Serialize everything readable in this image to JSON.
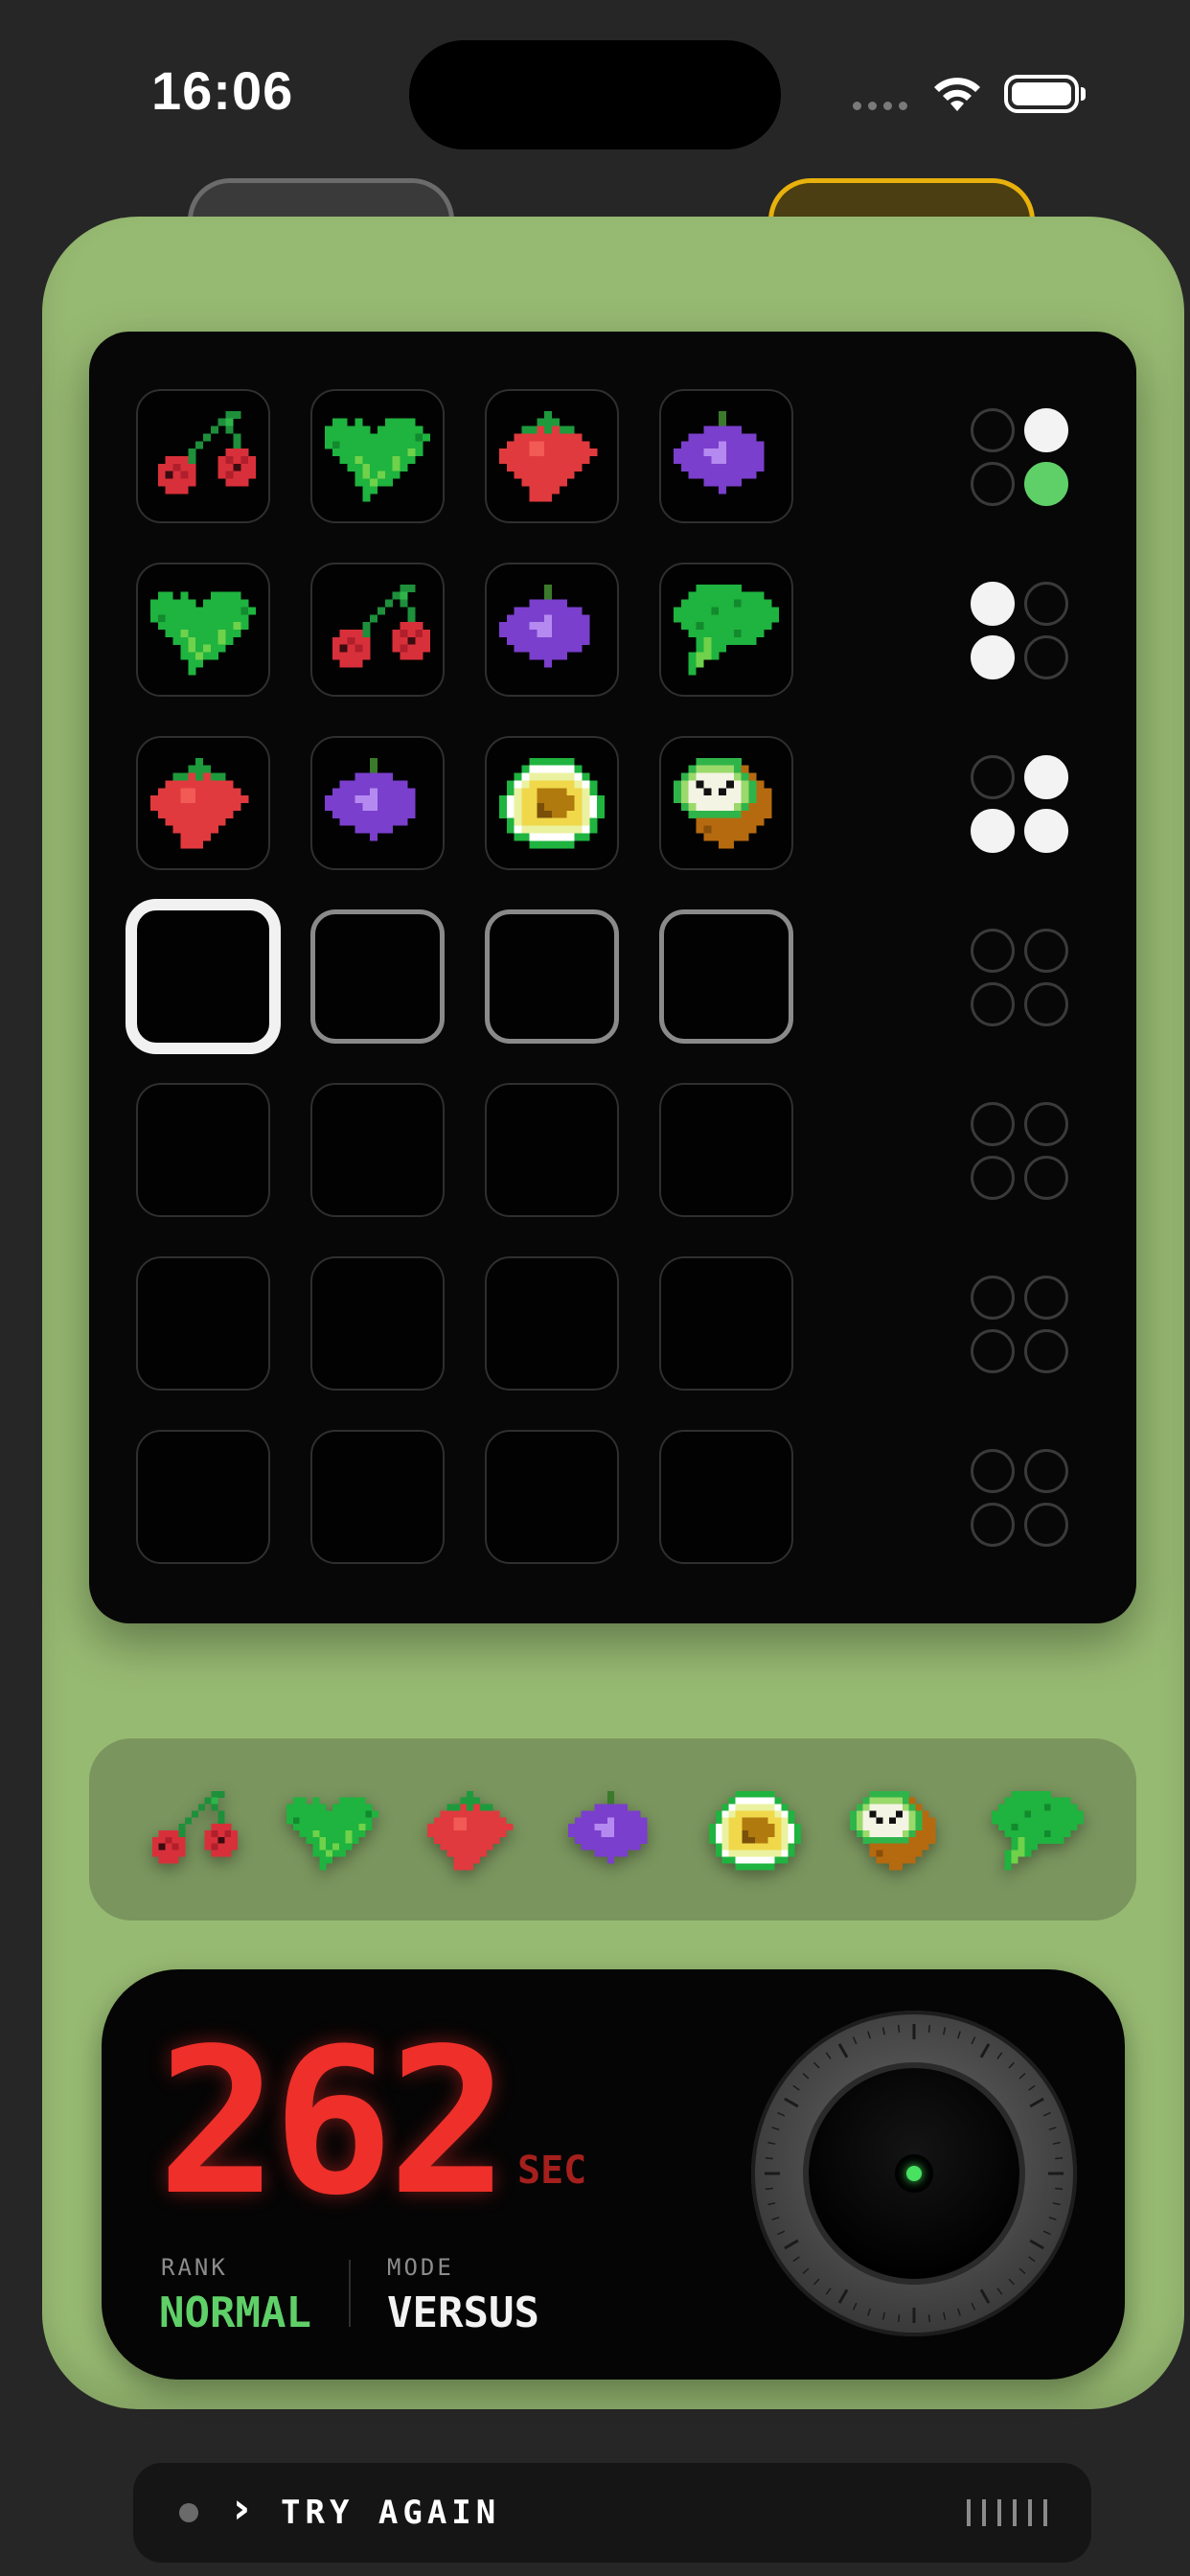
{
  "status_bar": {
    "time": "16:06",
    "icons": [
      "signal-dots-icon",
      "wifi-icon",
      "battery-icon"
    ]
  },
  "board": {
    "rows": [
      {
        "cells": [
          "cherry",
          "broccoli",
          "strawberry",
          "grape"
        ],
        "feedback": [
          "empty",
          "white",
          "empty",
          "green"
        ]
      },
      {
        "cells": [
          "broccoli",
          "cherry",
          "grape",
          "broccoli-tree"
        ],
        "feedback": [
          "white",
          "empty",
          "white",
          "empty"
        ]
      },
      {
        "cells": [
          "strawberry",
          "grape",
          "avocado",
          "kiwi"
        ],
        "feedback": [
          "empty",
          "white",
          "white",
          "white"
        ]
      },
      {
        "cells": [
          "",
          "",
          "",
          ""
        ],
        "feedback": [
          "empty",
          "empty",
          "empty",
          "empty"
        ],
        "state": "draft",
        "selected_index": 0
      },
      {
        "cells": [
          "",
          "",
          "",
          ""
        ],
        "feedback": [
          "empty",
          "empty",
          "empty",
          "empty"
        ]
      },
      {
        "cells": [
          "",
          "",
          "",
          ""
        ],
        "feedback": [
          "empty",
          "empty",
          "empty",
          "empty"
        ]
      },
      {
        "cells": [
          "",
          "",
          "",
          ""
        ],
        "feedback": [
          "empty",
          "empty",
          "empty",
          "empty"
        ]
      }
    ]
  },
  "palette": [
    "cherry",
    "broccoli",
    "strawberry",
    "grape",
    "avocado",
    "kiwi",
    "broccoli-tree"
  ],
  "score": {
    "value": "262",
    "unit": "SEC",
    "rank_label": "RANK",
    "rank_value": "NORMAL",
    "mode_label": "MODE",
    "mode_value": "VERSUS"
  },
  "action": {
    "label": "TRY AGAIN"
  },
  "colors": {
    "device": "#97ba72",
    "score": "#ee2f2a",
    "rank": "#5fd068",
    "peg_green": "#5fd068"
  }
}
